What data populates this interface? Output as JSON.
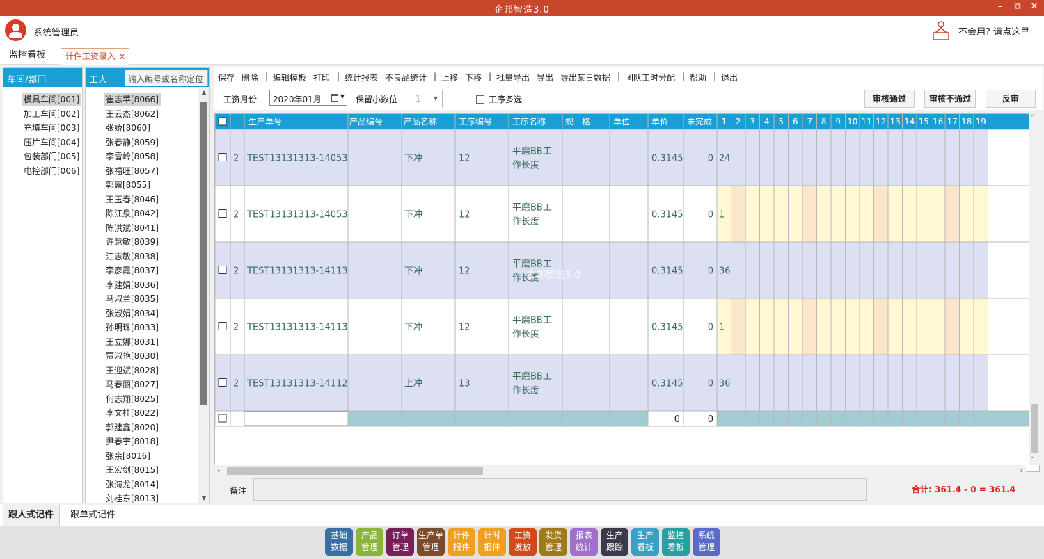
{
  "window": {
    "title": "企邦智造3.0",
    "controls": [
      "–",
      "⧉",
      "✕"
    ]
  },
  "user": {
    "name": "系统管理员",
    "help_text": "不会用? 请点这里"
  },
  "tabs": [
    {
      "label": "监控看板"
    },
    {
      "label": "计件工资录入",
      "close": "x"
    }
  ],
  "dept_panel": {
    "header": "车间/部门",
    "items": [
      "模具车间[001]",
      "加工车间[002]",
      "充填车间[003]",
      "压片车间[004]",
      "包装部门[005]",
      "电控部门[006]"
    ]
  },
  "worker_panel": {
    "header": "工人",
    "search_placeholder": "输入编号或名称定位",
    "items": [
      "崔志苹[8066]",
      "王云杰[8062]",
      "张娇[8060]",
      "张春静[8059]",
      "李雪岭[8058]",
      "张福旺[8057]",
      "郭露[8055]",
      "王玉春[8046]",
      "陈江泉[8042]",
      "陈洪斌[8041]",
      "许慧敏[8039]",
      "江志敏[8038]",
      "李彦霞[8037]",
      "李建娟[8036]",
      "马淑兰[8035]",
      "张淑娟[8034]",
      "孙明珠[8033]",
      "王立娜[8031]",
      "贾淑艳[8030]",
      "王迎斌[8028]",
      "马春丽[8027]",
      "何志翔[8025]",
      "李文桂[8022]",
      "郭建鑫[8020]",
      "尹春宇[8018]",
      "张余[8016]",
      "王宏剑[8015]",
      "张海龙[8014]",
      "刘桂东[8013]"
    ]
  },
  "toolbar": {
    "items": [
      "保存",
      "删除",
      "|",
      "编辑模板",
      "打印",
      "|",
      "统计报表",
      "不良品统计",
      "|",
      "上移",
      "下移",
      "|",
      "批量导出",
      "导出",
      "导出某日数据",
      "|",
      "团队工时分配",
      "|",
      "帮助",
      "|",
      "退出"
    ]
  },
  "filter": {
    "month_label": "工资月份",
    "month_value": "2020年01月",
    "decimals_label": "保留小数位",
    "decimals_value": "1",
    "multi_process_label": "工序多选",
    "approve_label": "审核通过",
    "reject_label": "审核不通过",
    "unapprove_label": "反审"
  },
  "grid": {
    "columns": [
      "生产单号",
      "产品编号",
      "产品名称",
      "工序编号",
      "工序名称",
      "规　格",
      "单位",
      "单价",
      "未完成",
      "1",
      "2",
      "3",
      "4",
      "5",
      "6",
      "7",
      "8",
      "9",
      "10",
      "11",
      "12",
      "13",
      "14",
      "15",
      "16",
      "17",
      "18",
      "19"
    ],
    "rows": [
      {
        "seq": "2",
        "order_no": "TEST13131313-14053",
        "product_no": "",
        "product_name": "下冲",
        "process_no": "12",
        "process_name": [
          "平磨BB工",
          "作长度"
        ],
        "spec": "",
        "unit": "",
        "price": "0.3145",
        "unfinished": "0",
        "day1": "24"
      },
      {
        "seq": "2",
        "order_no": "TEST13131313-14053",
        "product_no": "",
        "product_name": "下冲",
        "process_no": "12",
        "process_name": [
          "平磨BB工",
          "作长度"
        ],
        "spec": "",
        "unit": "",
        "price": "0.3145",
        "unfinished": "0",
        "day1": "1"
      },
      {
        "seq": "2",
        "order_no": "TEST13131313-14113",
        "product_no": "",
        "product_name": "下冲",
        "process_no": "12",
        "process_name": [
          "平磨BB工",
          "作长度"
        ],
        "spec": "",
        "unit": "",
        "price": "0.3145",
        "unfinished": "0",
        "day1": "36"
      },
      {
        "seq": "2",
        "order_no": "TEST13131313-14113",
        "product_no": "",
        "product_name": "下冲",
        "process_no": "12",
        "process_name": [
          "平磨BB工",
          "作长度"
        ],
        "spec": "",
        "unit": "",
        "price": "0.3145",
        "unfinished": "0",
        "day1": "1"
      },
      {
        "seq": "2",
        "order_no": "TEST13131313-14112",
        "product_no": "",
        "product_name": "上冲",
        "process_no": "13",
        "process_name": [
          "平磨BB工",
          "作长度"
        ],
        "spec": "",
        "unit": "",
        "price": "0.3145",
        "unfinished": "0",
        "day1": "36"
      }
    ],
    "summary": {
      "price_total": "0",
      "unfinished_total": "0"
    },
    "watermark": "企邦智造3.0"
  },
  "remark_label": "备注",
  "total_text": "合计:   361.4  -  0  =  361.4",
  "mode_tabs": {
    "active": "跟人式记件",
    "other": "跟单式记件"
  },
  "dock": [
    {
      "l1": "基础",
      "l2": "数据",
      "color": "#3a6ea5"
    },
    {
      "l1": "产品",
      "l2": "管理",
      "color": "#8cb43a"
    },
    {
      "l1": "订单",
      "l2": "管理",
      "color": "#7a1e5a"
    },
    {
      "l1": "生产单",
      "l2": "管理",
      "color": "#7a4a2a"
    },
    {
      "l1": "计件",
      "l2": "报件",
      "color": "#f0a020"
    },
    {
      "l1": "计时",
      "l2": "报件",
      "color": "#f0a020"
    },
    {
      "l1": "工资",
      "l2": "发放",
      "color": "#d24a1a"
    },
    {
      "l1": "发货",
      "l2": "管理",
      "color": "#a07a1a"
    },
    {
      "l1": "报表",
      "l2": "统计",
      "color": "#a070c8"
    },
    {
      "l1": "生产",
      "l2": "跟踪",
      "color": "#3a3a4a"
    },
    {
      "l1": "生产",
      "l2": "看板",
      "color": "#3aa0c8"
    },
    {
      "l1": "监控",
      "l2": "看板",
      "color": "#28a0a0"
    },
    {
      "l1": "系统",
      "l2": "管理",
      "color": "#5a6ac8"
    }
  ]
}
